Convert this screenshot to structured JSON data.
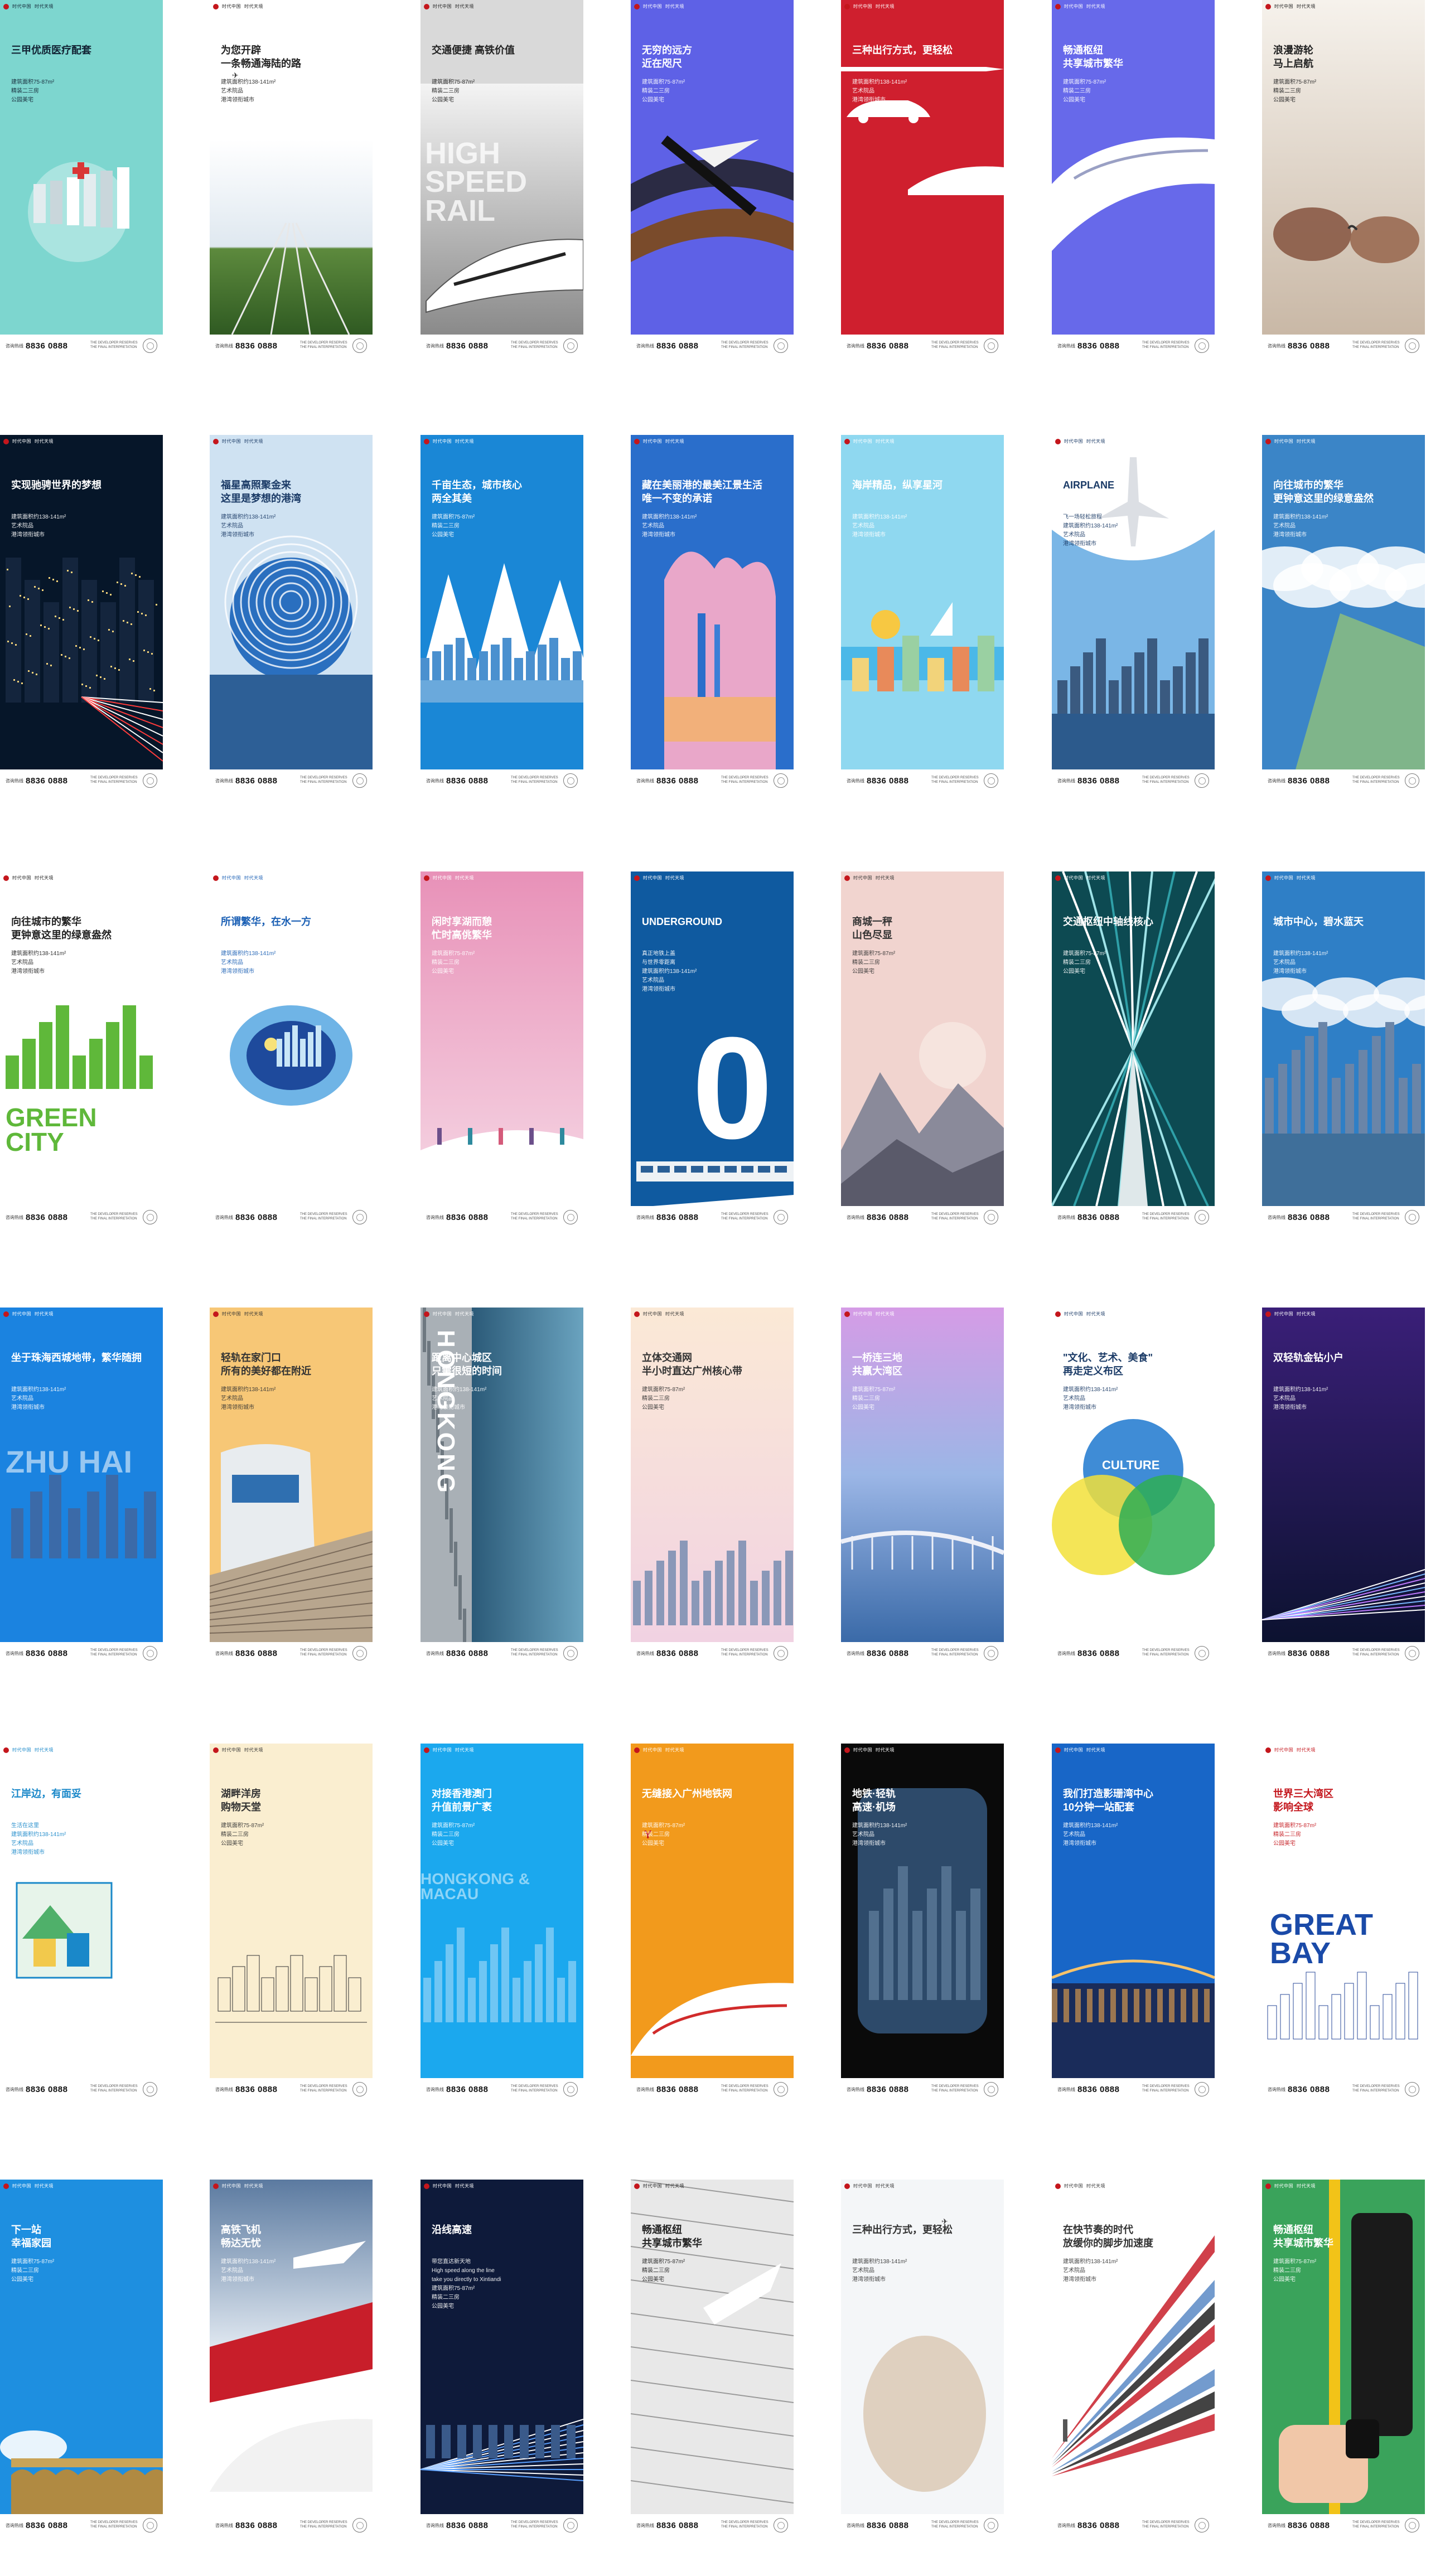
{
  "footer": {
    "phone": "8836 0888",
    "phone_prefix": "咨询热线",
    "note": "THE DEVELOPER RESERVES THE FINAL INTERPRETATION"
  },
  "brand": {
    "logo": "时代中国",
    "partner": "时代天境"
  },
  "posters": [
    {
      "id": "p01",
      "headline": "三甲优质医疗配套",
      "sub": [
        "建筑面积75-87m²",
        "精装二三房",
        "公园美宅"
      ],
      "bg": "#7dd6cf",
      "fg": "#123",
      "theme": "medical"
    },
    {
      "id": "p02",
      "headline": "为您开辟\n一条畅通海陆的路",
      "sub": [
        "建筑面积约138-141m²",
        "艺术院品",
        "港湾领衔城市"
      ],
      "bg": "#ffffff",
      "fg": "#222",
      "theme": "rail-grass"
    },
    {
      "id": "p03",
      "headline": "交通便捷 高铁价值",
      "sub": [
        "建筑面积75-87m²",
        "精装二三房",
        "公园美宅"
      ],
      "bg": "#d9d9d9",
      "fg": "#222",
      "theme": "highspeed",
      "big": "HIGH SPEED RAIL"
    },
    {
      "id": "p04",
      "headline": "无穷的远方\n近在咫尺",
      "sub": [
        "建筑面积75-87m²",
        "精装二三房",
        "公园美宅"
      ],
      "bg": "#5e61e6",
      "fg": "#fff",
      "theme": "highway"
    },
    {
      "id": "p05",
      "headline": "三种出行方式，更轻松",
      "sub": [
        "建筑面积约138-141m²",
        "艺术院品",
        "港湾领衔城市"
      ],
      "bg": "#cf1f2e",
      "fg": "#fff",
      "theme": "red-transport"
    },
    {
      "id": "p06",
      "headline": "畅通枢纽\n共享城市繁华",
      "sub": [
        "建筑面积75-87m²",
        "精装二三房",
        "公园美宅"
      ],
      "bg": "#6769ea",
      "fg": "#fff",
      "theme": "train-blue"
    },
    {
      "id": "p07",
      "headline": "浪漫游轮\n马上启航",
      "sub": [
        "建筑面积75-87m²",
        "精装二三房",
        "公园美宅"
      ],
      "bg": "#e9e4dd",
      "fg": "#222",
      "theme": "sunglasses"
    },
    {
      "id": "p08",
      "headline": "实现驰骋世界的梦想",
      "sub": [
        "建筑面积约138-141m²",
        "艺术院品",
        "港湾领衔城市"
      ],
      "bg": "#061629",
      "fg": "#fff",
      "theme": "night-city"
    },
    {
      "id": "p09",
      "headline": "福星高照聚金来\n这里是梦想的港湾",
      "sub": [
        "建筑面积约138-141m²",
        "艺术院品",
        "港湾领衔城市"
      ],
      "bg": "#cfe2f2",
      "fg": "#1a3a66",
      "theme": "rings"
    },
    {
      "id": "p10",
      "headline": "千亩生态，城市核心\n两全其美",
      "sub": [
        "建筑面积75-87m²",
        "精装二三房",
        "公园美宅"
      ],
      "bg": "#1a87d6",
      "fg": "#fff",
      "theme": "mountains"
    },
    {
      "id": "p11",
      "headline": "藏在美丽港的最美江景生活\n唯一不变的承诺",
      "sub": [
        "建筑面积约138-141m²",
        "艺术院品",
        "港湾领衔城市"
      ],
      "bg": "#2a6ecb",
      "fg": "#fff",
      "theme": "couple"
    },
    {
      "id": "p12",
      "headline": "海岸精品，纵享星河",
      "sub": [
        "建筑面积约138-141m²",
        "艺术院品",
        "港湾领衔城市"
      ],
      "bg": "#8fd8f0",
      "fg": "#fff",
      "theme": "sea-illus"
    },
    {
      "id": "p13",
      "headline": "AIRPLANE",
      "sub": [
        "飞一场轻松旅程",
        "建筑面积约138-141m²",
        "艺术院品",
        "港湾领衔城市"
      ],
      "bg": "#ffffff",
      "fg": "#1a3a66",
      "theme": "airplane"
    },
    {
      "id": "p14",
      "headline": "向往城市的繁华\n更钟意这里的绿意盎然",
      "sub": [
        "建筑面积约138-141m²",
        "艺术院品",
        "港湾领衔城市"
      ],
      "bg": "#3b85c7",
      "fg": "#fff",
      "theme": "clouds-tower"
    },
    {
      "id": "p15",
      "headline": "向往城市的繁华\n更钟意这里的绿意盎然",
      "sub": [
        "建筑面积约138-141m²",
        "艺术院品",
        "港湾领衔城市"
      ],
      "bg": "#ffffff",
      "fg": "#222",
      "theme": "green-city",
      "big": "GREEN CITY"
    },
    {
      "id": "p16",
      "headline": "所谓繁华，在水一方",
      "sub": [
        "建筑面积约138-141m²",
        "艺术院品",
        "港湾领衔城市"
      ],
      "bg": "#ffffff",
      "fg": "#1a5fb4",
      "theme": "papercut"
    },
    {
      "id": "p17",
      "headline": "闲时享湖而憩\n忙时高佻繁华",
      "sub": [
        "建筑面积75-87m²",
        "精装二三房",
        "公园美宅"
      ],
      "bg": "#e9a9c4",
      "fg": "#fff",
      "theme": "pink-walk"
    },
    {
      "id": "p18",
      "headline": "UNDERGROUND",
      "sub": [
        "真正地铁上盖",
        "与世界零距离",
        "建筑面积约138-141m²",
        "艺术院品",
        "港湾领衔城市"
      ],
      "bg": "#0f5aa0",
      "fg": "#fff",
      "theme": "zero",
      "big": "0"
    },
    {
      "id": "p19",
      "headline": "商城一秤\n山色尽显",
      "sub": [
        "建筑面积75-87m²",
        "精装二三房",
        "公园美宅"
      ],
      "bg": "#f1d4cf",
      "fg": "#333",
      "theme": "mountain-city"
    },
    {
      "id": "p20",
      "headline": "交通枢纽中轴线核心",
      "sub": [
        "建筑面积75-87m²",
        "精装二三房",
        "公园美宅"
      ],
      "bg": "#0d4a52",
      "fg": "#fff",
      "theme": "tunnel"
    },
    {
      "id": "p21",
      "headline": "城市中心，碧水蓝天",
      "sub": [
        "建筑面积约138-141m²",
        "艺术院品",
        "港湾领衔城市"
      ],
      "bg": "#2f7fc6",
      "fg": "#fff",
      "theme": "skyline-blue"
    },
    {
      "id": "p22",
      "headline": "坐于珠海西城地带，繁华随拥",
      "sub": [
        "建筑面积约138-141m²",
        "艺术院品",
        "港湾领衔城市"
      ],
      "bg": "#1b83e0",
      "fg": "#fff",
      "theme": "zhuhai",
      "big": "ZHU HAI"
    },
    {
      "id": "p23",
      "headline": "轻轨在家门口\n所有的美好都在附近",
      "sub": [
        "建筑面积约138-141m²",
        "艺术院品",
        "港湾领衔城市"
      ],
      "bg": "#f7c776",
      "fg": "#333",
      "theme": "metro-train"
    },
    {
      "id": "p24",
      "headline": "距离中心城区\n只需很短的时间",
      "sub": [
        "建筑面积约138-141m²",
        "艺术院品",
        "港湾领衔城市"
      ],
      "bg": "#3d6e8a",
      "fg": "#fff",
      "theme": "hongkong",
      "big": "HONGKONG"
    },
    {
      "id": "p25",
      "headline": "立体交通网\n半小时直达广州核心带",
      "sub": [
        "建筑面积75-87m²",
        "精装二三房",
        "公园美宅"
      ],
      "bg": "#fbe8d4",
      "fg": "#333",
      "theme": "skyline-warm"
    },
    {
      "id": "p26",
      "headline": "一桥连三地\n共赢大湾区",
      "sub": [
        "建筑面积75-87m²",
        "精装二三房",
        "公园美宅"
      ],
      "bg": "#d6a6e0",
      "fg": "#fff",
      "theme": "bridge-purple"
    },
    {
      "id": "p27",
      "headline": "\"文化、艺术、美食\"\n再走定义布区",
      "sub": [
        "建筑面积约138-141m²",
        "艺术院品",
        "港湾领衔城市"
      ],
      "bg": "#ffffff",
      "fg": "#1a3a66",
      "theme": "culture",
      "big": "CULTURE"
    },
    {
      "id": "p28",
      "headline": "双轻轨金钻小户",
      "sub": [
        "建筑面积约138-141m²",
        "艺术院品",
        "港湾领衔城市"
      ],
      "bg": "#1b1340",
      "fg": "#fff",
      "theme": "light-trail"
    },
    {
      "id": "p29",
      "headline": "江岸边，有面妥",
      "sub": [
        "生活在这里",
        "建筑面积约138-141m²",
        "艺术院品",
        "港湾领衔城市"
      ],
      "bg": "#ffffff",
      "fg": "#1a88c9",
      "theme": "illus-house"
    },
    {
      "id": "p30",
      "headline": "湖畔洋房\n购物天堂",
      "sub": [
        "建筑面积75-87m²",
        "精装二三房",
        "公园美宅"
      ],
      "bg": "#faeed0",
      "fg": "#333",
      "theme": "sketch"
    },
    {
      "id": "p31",
      "headline": "对接香港澳门\n升值前景广袤",
      "sub": [
        "建筑面积75-87m²",
        "精装二三房",
        "公园美宅"
      ],
      "bg": "#1ba8ee",
      "fg": "#fff",
      "theme": "hk-macau",
      "big": "HONGKONG & MACAU"
    },
    {
      "id": "p32",
      "headline": "无缝接入广州地铁网",
      "sub": [
        "建筑面积75-87m²",
        "精装二三房",
        "公园美宅"
      ],
      "bg": "#f29a1c",
      "fg": "#fff",
      "theme": "orange-train"
    },
    {
      "id": "p33",
      "headline": "地铁·轻轨\n高速·机场",
      "sub": [
        "建筑面积约138-141m²",
        "艺术院品",
        "港湾领衔城市"
      ],
      "bg": "#0a0a0a",
      "fg": "#fff",
      "theme": "window-city"
    },
    {
      "id": "p34",
      "headline": "我们打造影珊湾中心\n10分钟一站配套",
      "sub": [
        "建筑面积约138-141m²",
        "艺术院品",
        "港湾领衔城市"
      ],
      "bg": "#1866c7",
      "fg": "#fff",
      "theme": "bridge-night"
    },
    {
      "id": "p35",
      "headline": "世界三大湾区\n影响全球",
      "sub": [
        "建筑面积75-87m²",
        "精装二三房",
        "公园美宅"
      ],
      "bg": "#ffffff",
      "fg": "#c4161c",
      "theme": "great-bay",
      "big": "GREAT BAY"
    },
    {
      "id": "p36",
      "headline": "下一站\n幸福家园",
      "sub": [
        "建筑面积75-87m²",
        "精装二三房",
        "公园美宅"
      ],
      "bg": "#1e8fe0",
      "fg": "#fff",
      "theme": "aqueduct"
    },
    {
      "id": "p37",
      "headline": "高铁飞机\n畅达无忧",
      "sub": [
        "建筑面积约138-141m²",
        "艺术院品",
        "港湾领衔城市"
      ],
      "bg": "#ffffff",
      "fg": "#fff",
      "theme": "plane-train"
    },
    {
      "id": "p38",
      "headline": "沿线高速",
      "sub": [
        "带您直达新天地",
        "High speed along the line",
        "take you directly to Xintiandi",
        "建筑面积75-87m²",
        "精装二三房",
        "公园美宅"
      ],
      "bg": "#0e1a3a",
      "fg": "#fff",
      "theme": "speed-lights"
    },
    {
      "id": "p39",
      "headline": "畅通枢纽\n共享城市繁华",
      "sub": [
        "建筑面积75-87m²",
        "精装二三房",
        "公园美宅"
      ],
      "bg": "#e8e8e8",
      "fg": "#222",
      "theme": "aerial-plane"
    },
    {
      "id": "p40",
      "headline": "三种出行方式，更轻松",
      "sub": [
        "建筑面积约138-141m²",
        "艺术院品",
        "港湾领衔城市"
      ],
      "bg": "#f4f6f8",
      "fg": "#333",
      "theme": "child-window"
    },
    {
      "id": "p41",
      "headline": "在快节奏的时代\n放缓你的脚步加速度",
      "sub": [
        "建筑面积约138-141m²",
        "艺术院品",
        "港湾领衔城市"
      ],
      "bg": "#ffffff",
      "fg": "#333",
      "theme": "perspective"
    },
    {
      "id": "p42",
      "headline": "畅通枢纽\n共享城市繁华",
      "sub": [
        "建筑面积75-87m²",
        "精装二三房",
        "公园美宅"
      ],
      "bg": "#3aa35b",
      "fg": "#fff",
      "theme": "card-reader"
    }
  ]
}
